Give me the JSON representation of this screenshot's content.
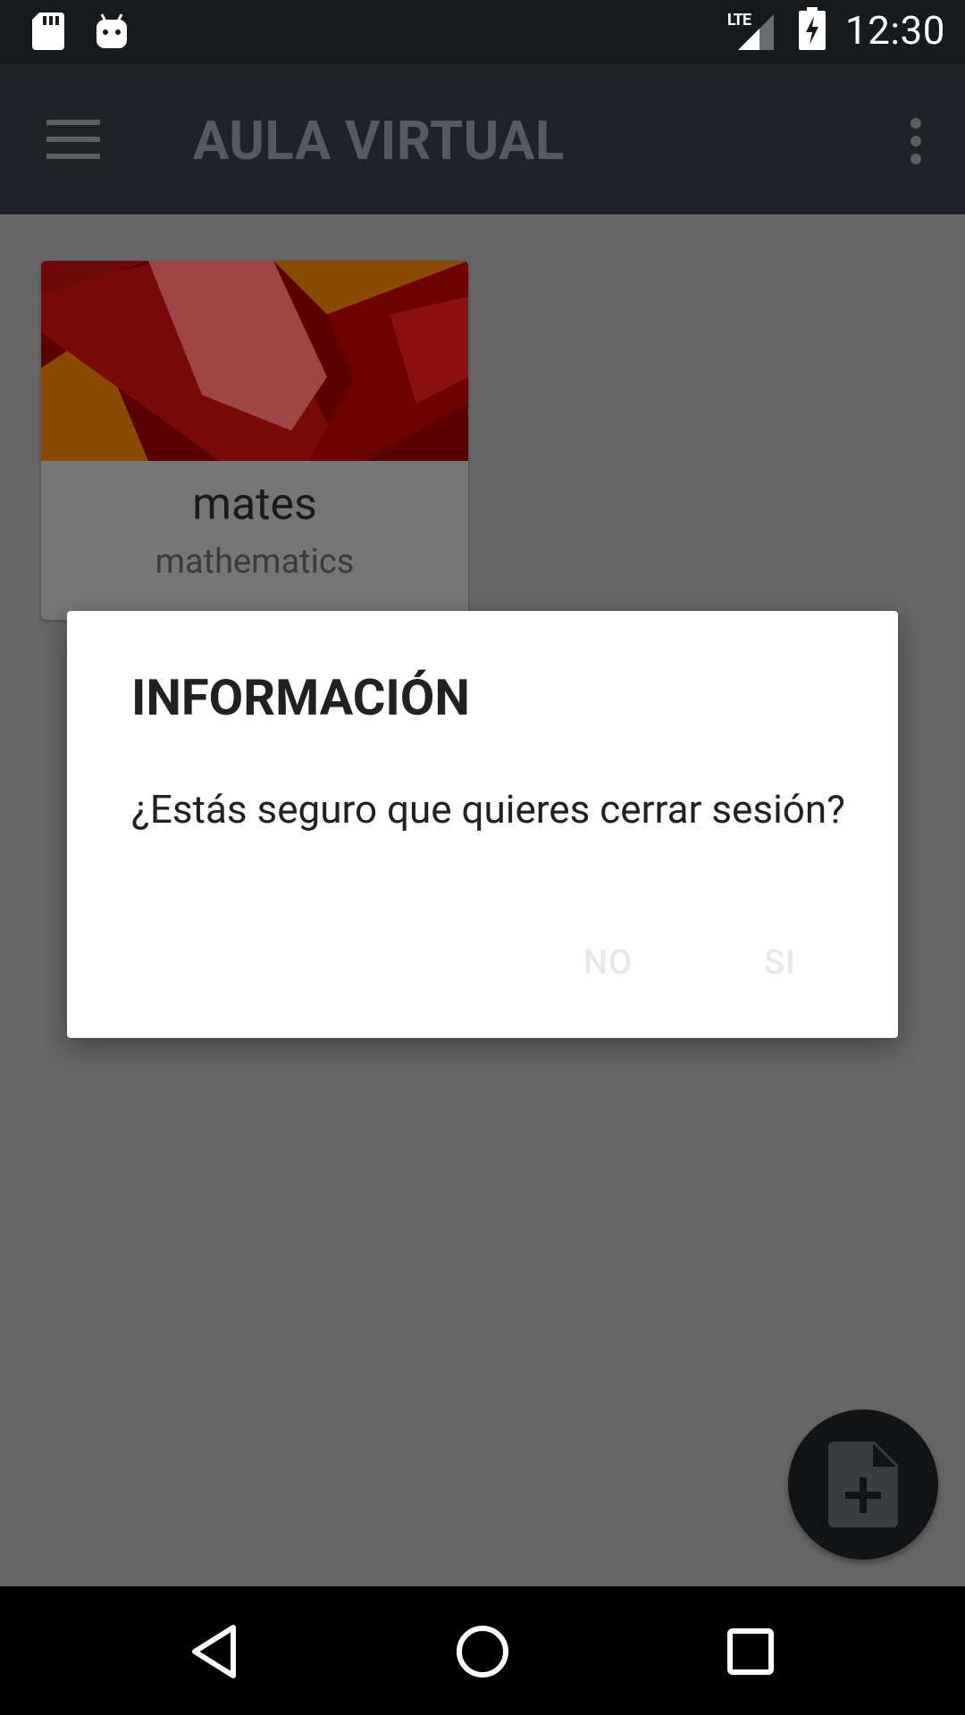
{
  "status_bar": {
    "time": "12:30",
    "network_label": "LTE",
    "icons": [
      "sd-card-icon",
      "android-debug-icon",
      "lte-signal-icon",
      "battery-charging-icon"
    ]
  },
  "app_bar": {
    "title": "AULA VIRTUAL",
    "icons": [
      "hamburger-menu-icon",
      "overflow-menu-icon"
    ]
  },
  "courses": [
    {
      "title": "mates",
      "subtitle": "mathematics"
    }
  ],
  "dialog": {
    "title": "INFORMACIÓN",
    "message": "¿Estás seguro que quieres cerrar sesión?",
    "negative_button": "NO",
    "positive_button": "SI"
  },
  "fab": {
    "icon": "add-document-icon"
  },
  "nav_bar": {
    "icons": [
      "back-icon",
      "home-icon",
      "recents-icon"
    ]
  },
  "colors": {
    "status_bar": "#161a1c",
    "app_bar": "#1f2327",
    "scrim_background": "#666666",
    "dialog_background": "#ffffff",
    "dialog_button_text": "#e8e8e8",
    "card_red": "#8b0000",
    "card_orange": "#b35a00"
  }
}
